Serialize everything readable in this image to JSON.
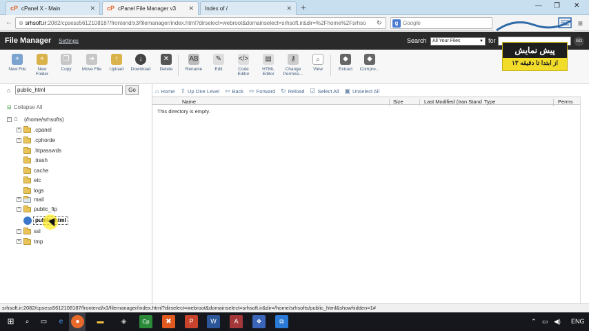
{
  "browser": {
    "tabs": [
      {
        "title": "cPanel X - Main",
        "active": false
      },
      {
        "title": "cPanel File Manager v3",
        "active": true
      },
      {
        "title": "Index of /",
        "active": false
      }
    ],
    "url_host": "srhsoft.ir",
    "url_rest": ":2082/cpsess5612108187/frontend/x3/filemanager/index.html?dirselect=webroot&domainselect=srhsoft.ir&dir=%2Fhome%2Fsrhso",
    "search_placeholder": "Google",
    "status_url": "srhsoft.ir:2082/cpsess5612108187/frontend/x3/filemanager/index.html?dirselect=webroot&domainselect=srhsoft.ir&dir=/home/srhsofts/public_html&showhidden=1#"
  },
  "header": {
    "title": "File Manager",
    "settings": "Settings",
    "search_label": "Search",
    "search_scope": "All Your Files",
    "for_label": "for",
    "go_label": "GO"
  },
  "promo": {
    "line1": "پیش نمایش",
    "line2": "از ابتدا تا دقیقه ۱۳"
  },
  "toolbar": {
    "new_file": "New File",
    "new_folder_1": "New",
    "new_folder_2": "Folder",
    "copy": "Copy",
    "move_file": "Move File",
    "upload": "Upload",
    "download": "Download",
    "delete": "Delete",
    "rename": "Rename",
    "edit": "Edit",
    "code_editor_1": "Code",
    "code_editor_2": "Editor",
    "html_editor_1": "HTML",
    "html_editor_2": "Editor",
    "change_perms_1": "Change",
    "change_perms_2": "Permiss...",
    "view": "View",
    "extract": "Extract",
    "compress": "Compre..."
  },
  "left": {
    "path_value": "public_html",
    "go": "Go",
    "collapse_all": "Collapse All",
    "root": "(/home/srhsofts)",
    "folders": [
      ".cpanel",
      ".cphorde",
      ".htpasswds",
      ".trash",
      "cache",
      "etc",
      "logs",
      "mail",
      "public_ftp",
      "public_html",
      "ssl",
      "tmp"
    ]
  },
  "right": {
    "nav": [
      "Home",
      "Up One Level",
      "Back",
      "Forward",
      "Reload",
      "Select All",
      "Unselect All"
    ],
    "columns": [
      "Name",
      "Size",
      "Last Modified (Iran Stand",
      "Type",
      "Perms"
    ],
    "empty_message": "This directory is empty."
  },
  "taskbar": {
    "language": "ENG"
  }
}
